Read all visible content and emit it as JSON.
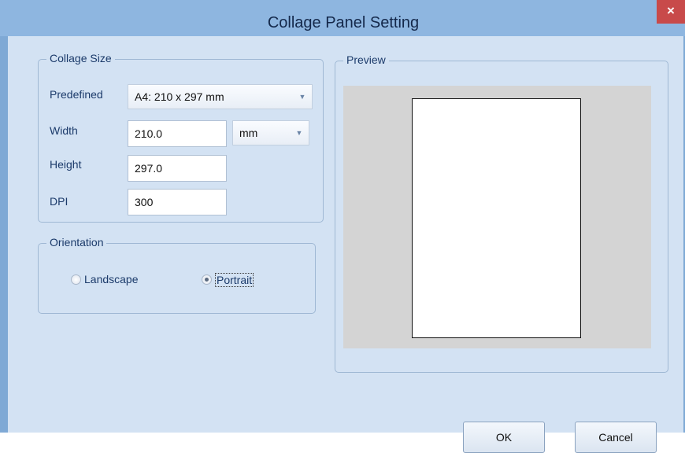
{
  "window": {
    "title": "Collage Panel Setting",
    "close_glyph": "×"
  },
  "collage_size": {
    "legend": "Collage Size",
    "predefined_label": "Predefined",
    "predefined_value": "A4: 210 x 297 mm",
    "width_label": "Width",
    "width_value": "210.0",
    "unit_value": "mm",
    "height_label": "Height",
    "height_value": "297.0",
    "dpi_label": "DPI",
    "dpi_value": "300"
  },
  "orientation": {
    "legend": "Orientation",
    "landscape_label": "Landscape",
    "portrait_label": "Portrait",
    "selected": "Portrait"
  },
  "preview": {
    "legend": "Preview"
  },
  "buttons": {
    "ok_label": "OK",
    "cancel_label": "Cancel"
  },
  "colors": {
    "title_bar": "#8eb6e0",
    "dialog_background": "#d3e2f3",
    "close_button": "#c84a4a",
    "preview_background": "#d4d4d4"
  }
}
